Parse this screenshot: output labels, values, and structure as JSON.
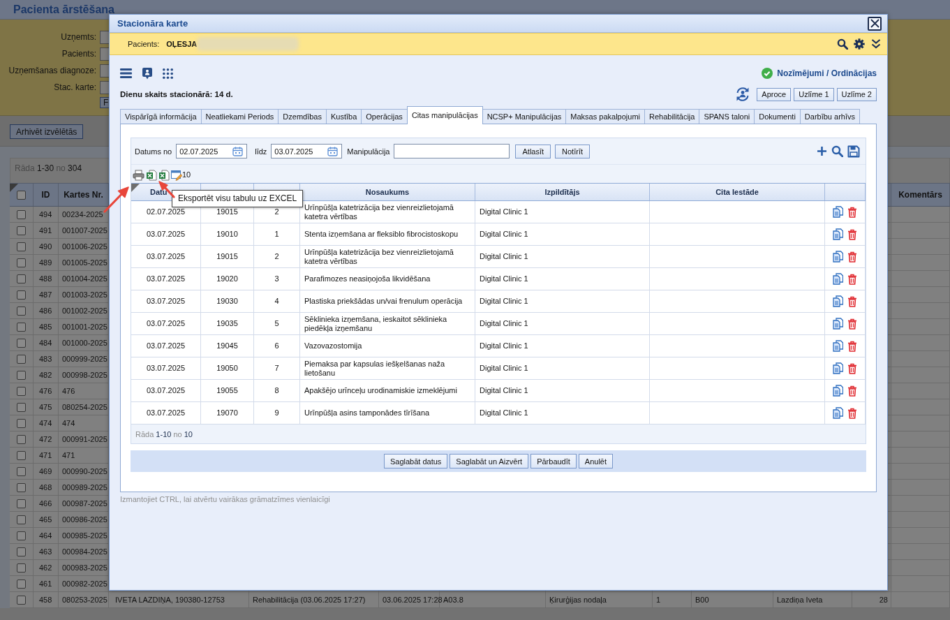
{
  "background_page": {
    "title": "Pacienta ārstēšana",
    "filters": [
      {
        "label": "Uzņemts:"
      },
      {
        "label": "Pacients:"
      },
      {
        "label": "Uzņemšanas diagnoze:"
      },
      {
        "label": "Stac. karte:"
      }
    ],
    "filter_button": "F",
    "archive_button": "Arhivēt izvēlētās",
    "pager": {
      "label": "Rāda",
      "range": "1-30",
      "of": "no",
      "total": "304"
    },
    "table": {
      "select_all": {
        "checked": false
      },
      "columns": [
        {
          "label": "ID"
        },
        {
          "label": "Kartes Nr."
        },
        {},
        {},
        {},
        {},
        {},
        {},
        {},
        {},
        {},
        {
          "label": "Komentārs"
        }
      ],
      "rows": [
        {
          "checked": false,
          "cells": [
            "494",
            "00234-2025"
          ]
        },
        {
          "checked": false,
          "cells": [
            "491",
            "001007-2025"
          ]
        },
        {
          "checked": false,
          "cells": [
            "490",
            "001006-2025"
          ]
        },
        {
          "checked": false,
          "cells": [
            "489",
            "001005-2025"
          ]
        },
        {
          "checked": false,
          "cells": [
            "488",
            "001004-2025"
          ]
        },
        {
          "checked": false,
          "cells": [
            "487",
            "001003-2025"
          ]
        },
        {
          "checked": false,
          "cells": [
            "486",
            "001002-2025"
          ]
        },
        {
          "checked": false,
          "cells": [
            "485",
            "001001-2025"
          ]
        },
        {
          "checked": false,
          "cells": [
            "484",
            "001000-2025"
          ]
        },
        {
          "checked": false,
          "cells": [
            "483",
            "000999-2025"
          ]
        },
        {
          "checked": false,
          "cells": [
            "482",
            "000998-2025"
          ]
        },
        {
          "checked": false,
          "cells": [
            "476",
            "476"
          ]
        },
        {
          "checked": false,
          "cells": [
            "475",
            "080254-2025"
          ]
        },
        {
          "checked": false,
          "cells": [
            "474",
            "474"
          ]
        },
        {
          "checked": false,
          "cells": [
            "472",
            "000991-2025"
          ]
        },
        {
          "checked": false,
          "cells": [
            "471",
            "471"
          ]
        },
        {
          "checked": false,
          "cells": [
            "469",
            "000990-2025"
          ]
        },
        {
          "checked": false,
          "cells": [
            "468",
            "000989-2025"
          ]
        },
        {
          "checked": false,
          "cells": [
            "466",
            "000987-2025"
          ]
        },
        {
          "checked": false,
          "cells": [
            "465",
            "000986-2025"
          ]
        },
        {
          "checked": false,
          "cells": [
            "464",
            "000985-2025"
          ]
        },
        {
          "checked": false,
          "cells": [
            "463",
            "000984-2025"
          ]
        },
        {
          "checked": false,
          "cells": [
            "462",
            "000983-2025"
          ]
        },
        {
          "checked": false,
          "cells": [
            "461",
            "000982-2025"
          ]
        },
        {
          "checked": false,
          "cells": [
            "458",
            "080253-2025",
            "IVETA LAZDIŅA, 190380-12753",
            "Rehabilitācija (03.06.2025 17:27)",
            "03.06.2025 17:28",
            "A03.8",
            "Ķirurģijas nodaļa",
            "1",
            "B00",
            "Lazdiņa Iveta",
            "28"
          ]
        }
      ]
    }
  },
  "dialog": {
    "title": "Stacionāra karte",
    "patient": {
      "label": "Pacients:",
      "name": "OĻESJA",
      "name_blurred": true
    },
    "nav_link": "Nozīmējumi / Ordinācijas",
    "days_in_hospital": "Dienu skaits stacionārā: 14 d.",
    "print_buttons": [
      "Aproce",
      "Uzlīme 1",
      "Uzlīme 2"
    ],
    "tabs": [
      {
        "label": "Vispārīgā informācija",
        "selected": false
      },
      {
        "label": "Neatliekami Periods",
        "selected": false
      },
      {
        "label": "Dzemdības",
        "selected": false
      },
      {
        "label": "Kustība",
        "selected": false
      },
      {
        "label": "Operācijas",
        "selected": false
      },
      {
        "label": "Citas manipulācijas",
        "selected": true
      },
      {
        "label": "NCSP+ Manipulācijas",
        "selected": false
      },
      {
        "label": "Maksas pakalpojumi",
        "selected": false
      },
      {
        "label": "Rehabilitācija",
        "selected": false
      },
      {
        "label": "SPANS taloni",
        "selected": false
      },
      {
        "label": "Dokumenti",
        "selected": false
      },
      {
        "label": "Darbību arhīvs",
        "selected": false
      }
    ],
    "filter": {
      "date_from_label": "Datums no",
      "date_from": "02.07.2025",
      "date_to_label": "līdz",
      "date_to": "03.07.2025",
      "manipulation_label": "Manipulācija",
      "buttons": [
        "Atlasīt",
        "Notīrīt"
      ]
    },
    "page_size": "10",
    "tooltip": "Eksportēt visu tabulu uz EXCEL",
    "table": {
      "columns": [
        {
          "label": "Datu"
        },
        {},
        {},
        {
          "label": "Nosaukums"
        },
        {
          "label": "Izpildītājs"
        },
        {
          "label": "Cita Iestāde"
        },
        {}
      ],
      "rows": [
        {
          "cells": [
            "02.07.2025",
            "19015",
            "2",
            "Urīnpūšļa katetrizācija bez vienreizlietojamā katetra vērtības",
            "Digital Clinic 1"
          ]
        },
        {
          "cells": [
            "03.07.2025",
            "19010",
            "1",
            "Stenta izņemšana ar fleksiblo fibrocistoskopu",
            "Digital Clinic 1"
          ]
        },
        {
          "cells": [
            "03.07.2025",
            "19015",
            "2",
            "Urīnpūšļa katetrizācija bez vienreizlietojamā katetra vērtības",
            "Digital Clinic 1"
          ]
        },
        {
          "cells": [
            "03.07.2025",
            "19020",
            "3",
            "Parafimozes neasiņojoša likvidēšana",
            "Digital Clinic 1"
          ]
        },
        {
          "cells": [
            "03.07.2025",
            "19030",
            "4",
            "Plastiska priekšādas un/vai frenulum operācija",
            "Digital Clinic 1"
          ]
        },
        {
          "cells": [
            "03.07.2025",
            "19035",
            "5",
            "Sēklinieka izņemšana, ieskaitot sēklinieka piedēkļa izņemšanu",
            "Digital Clinic 1"
          ]
        },
        {
          "cells": [
            "03.07.2025",
            "19045",
            "6",
            "Vazovazostomija",
            "Digital Clinic 1"
          ]
        },
        {
          "cells": [
            "03.07.2025",
            "19050",
            "7",
            "Piemaksa par kapsulas iešķelšanas naža lietošanu",
            "Digital Clinic 1"
          ]
        },
        {
          "cells": [
            "03.07.2025",
            "19055",
            "8",
            "Apakšējo urīnceļu urodinamiskie izmeklējumi",
            "Digital Clinic 1"
          ]
        },
        {
          "cells": [
            "03.07.2025",
            "19070",
            "9",
            "Urīnpūšļa asins tamponādes tīrīšana",
            "Digital Clinic 1"
          ]
        }
      ]
    },
    "pager": {
      "label": "Rāda",
      "range": "1-10",
      "of": "no",
      "total": "10"
    },
    "footer_buttons": [
      "Saglabāt datus",
      "Saglabāt un Aizvērt",
      "Pārbaudīt",
      "Anulēt"
    ],
    "hint": "Izmantojiet CTRL, lai atvērtu vairākas grāmatzīmes vienlaicīgi"
  }
}
